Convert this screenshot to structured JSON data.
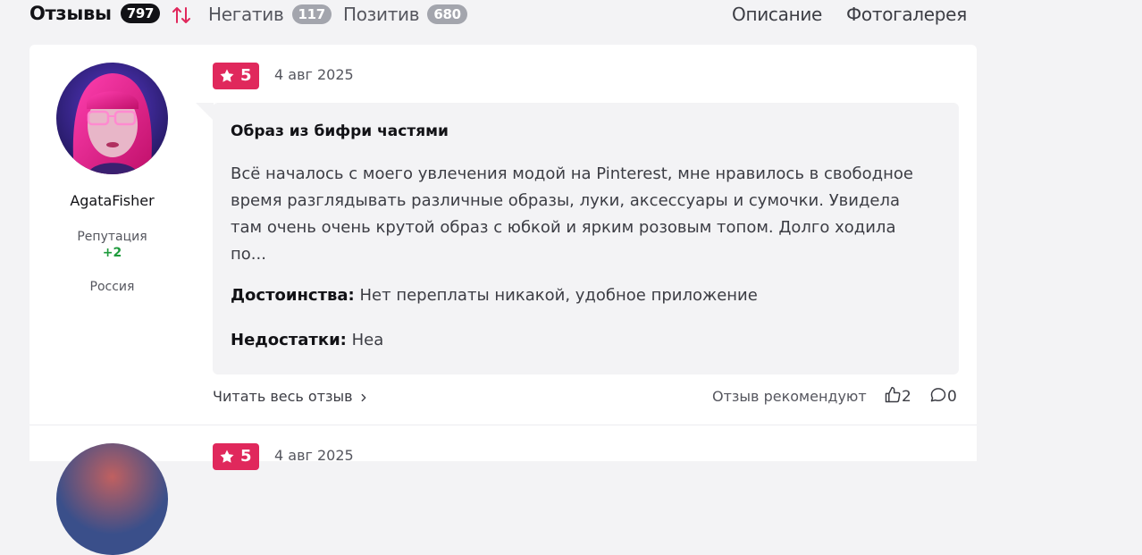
{
  "tabs": {
    "reviews_label": "Отзывы",
    "reviews_count": "797",
    "negative_label": "Негатив",
    "negative_count": "117",
    "positive_label": "Позитив",
    "positive_count": "680",
    "description_label": "Описание",
    "gallery_label": "Фотогалерея"
  },
  "reviews": [
    {
      "username": "AgataFisher",
      "reputation_label": "Репутация",
      "reputation_value": "+2",
      "country": "Россия",
      "rating": "5",
      "date": "4 авг 2025",
      "title": "Образ из бифри частями",
      "text": "Всё началось с моего увлечения модой на Pinterest, мне нравилось в свободное время разглядывать различные образы, луки, аксессуары и сумочки. Увидела там очень очень крутой образ с юбкой и ярким розовым топом. Долго ходила по...",
      "pros_label": "Достоинства:",
      "pros": "Нет переплаты никакой, удобное приложение",
      "cons_label": "Недостатки:",
      "cons": "Неа",
      "read_more": "Читать весь отзыв",
      "recommend_label": "Отзыв рекомендуют",
      "likes": "2",
      "comments": "0"
    },
    {
      "rating": "5",
      "date": "4 авг 2025"
    }
  ],
  "colors": {
    "accent": "#e0285c",
    "reputation_positive": "#1e9b3c",
    "background": "#f3f3f5"
  },
  "icons": [
    "sort-icon",
    "star-icon",
    "chevron-right-icon",
    "thumbs-up-icon",
    "comment-icon"
  ]
}
